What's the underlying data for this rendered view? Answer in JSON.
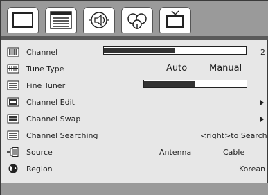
{
  "tabs": [
    {
      "icon": "picture-icon",
      "active": true
    },
    {
      "icon": "channel-list-icon",
      "active": false
    },
    {
      "icon": "sound-icon",
      "active": false
    },
    {
      "icon": "setup-icon",
      "active": false
    },
    {
      "icon": "tv-icon",
      "active": false
    }
  ],
  "menu": {
    "channel": {
      "label": "Channel",
      "value": "2",
      "level": 0.5
    },
    "tune_type": {
      "label": "Tune Type",
      "option_a": "Auto",
      "option_b": "Manual"
    },
    "fine_tuner": {
      "label": "Fine Tuner",
      "level": 0.49
    },
    "channel_edit": {
      "label": "Channel Edit"
    },
    "channel_swap": {
      "label": "Channel Swap"
    },
    "channel_searching": {
      "label": "Channel Searching",
      "hint": "<right>to Search"
    },
    "source": {
      "label": "Source",
      "option_a": "Antenna",
      "option_b": "Cable"
    },
    "region": {
      "label": "Region",
      "value": "Korean"
    }
  }
}
